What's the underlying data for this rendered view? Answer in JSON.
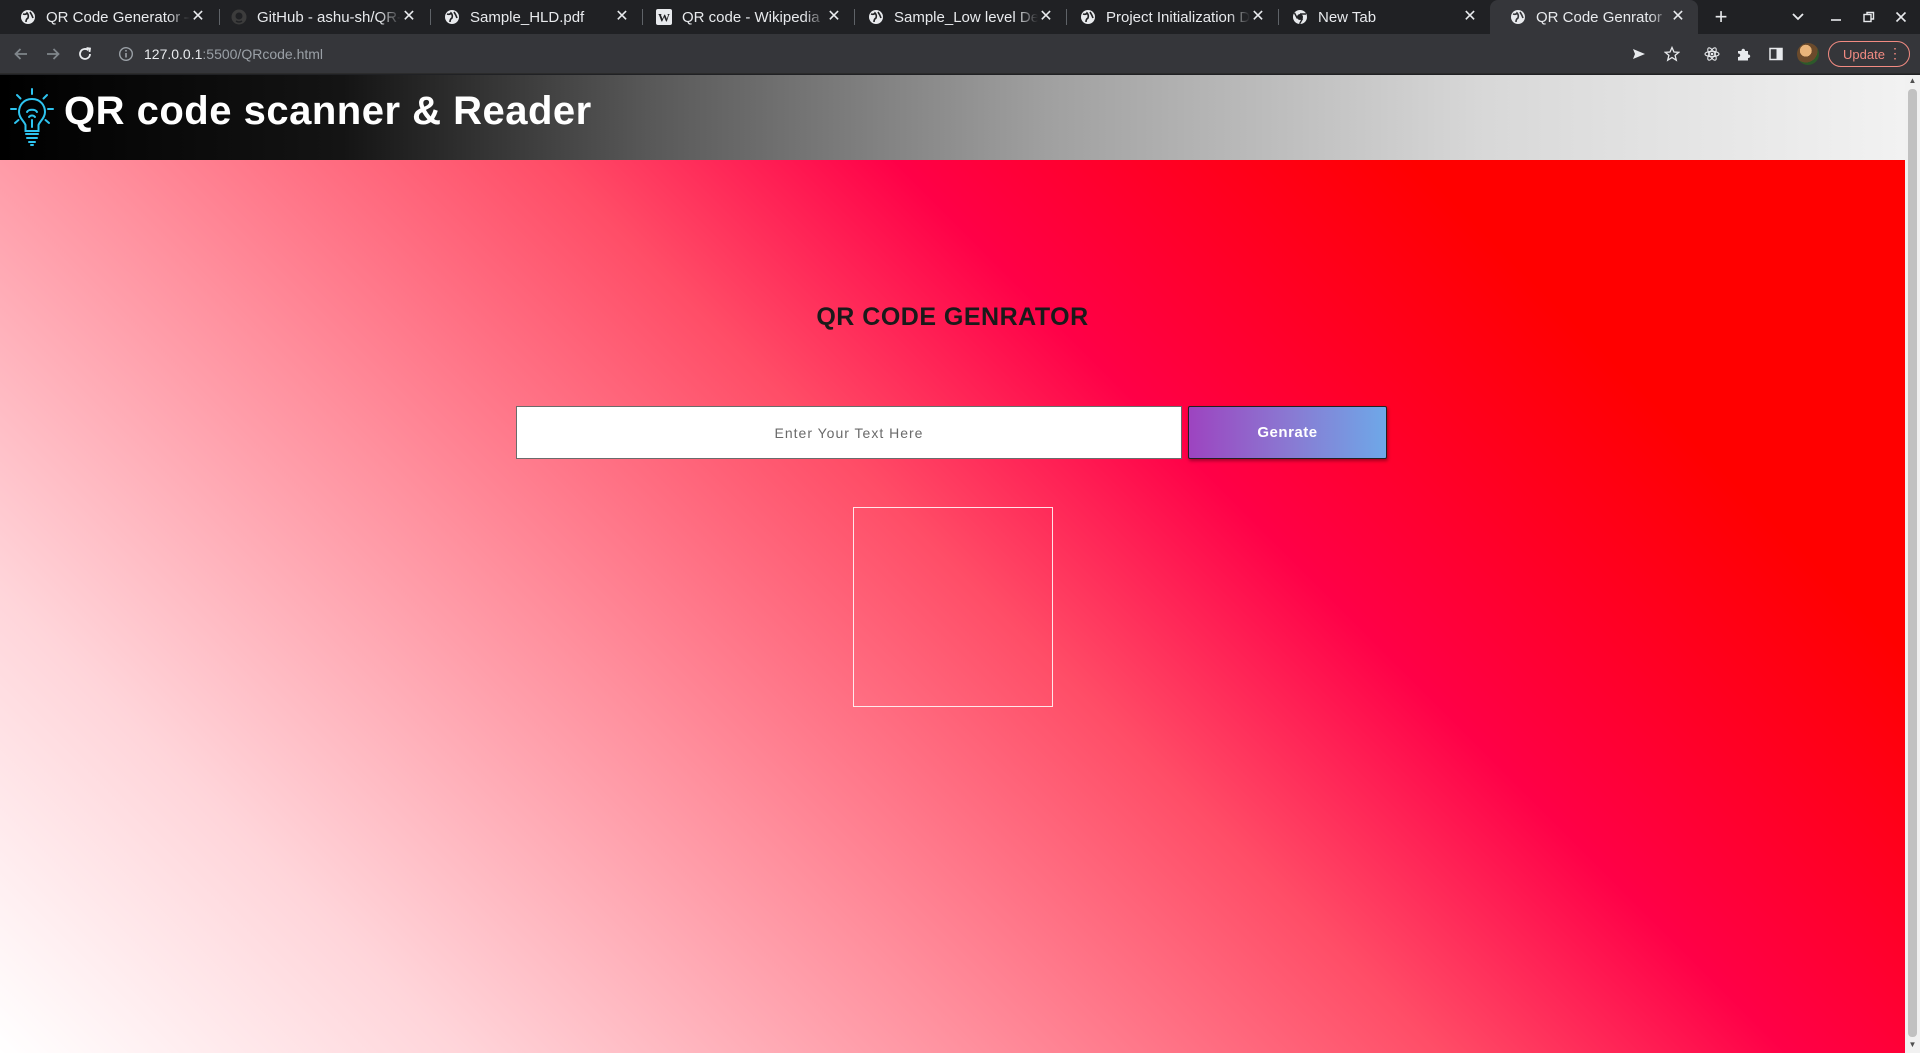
{
  "browser": {
    "tabs": [
      {
        "title": "QR Code Generator – ",
        "icon": "globe-icon",
        "active": false
      },
      {
        "title": "GitHub - ashu-sh/QR-",
        "icon": "github-icon",
        "active": false
      },
      {
        "title": "Sample_HLD.pdf",
        "icon": "globe-icon",
        "active": false
      },
      {
        "title": "QR code - Wikipedia",
        "icon": "wikipedia-icon",
        "active": false
      },
      {
        "title": "Sample_Low level De",
        "icon": "globe-icon",
        "active": false
      },
      {
        "title": "Project Initialization D",
        "icon": "globe-icon",
        "active": false
      },
      {
        "title": "New Tab",
        "icon": "chrome-icon",
        "active": false
      },
      {
        "title": "QR Code Genrator",
        "icon": "globe-icon",
        "active": true
      }
    ],
    "close_glyph": "✕",
    "new_tab_glyph": "+",
    "url": {
      "host": "127.0.0.1",
      "rest": ":5500/QRcode.html"
    },
    "update_label": "Update"
  },
  "page": {
    "site_title": "QR code scanner & Reader",
    "heading": "QR CODE GENRATOR",
    "input": {
      "placeholder": "Enter Your Text Here",
      "value": ""
    },
    "button_label": "Genrate"
  },
  "colors": {
    "chrome_bg": "#202124",
    "toolbar_bg": "#35363a",
    "update_accent": "#f28b82",
    "page_gradient_red": "#ff0000",
    "page_gradient_pink": "#ff0047",
    "button_gradient_start": "#9d44c0",
    "button_gradient_end": "#6ea8e8"
  }
}
